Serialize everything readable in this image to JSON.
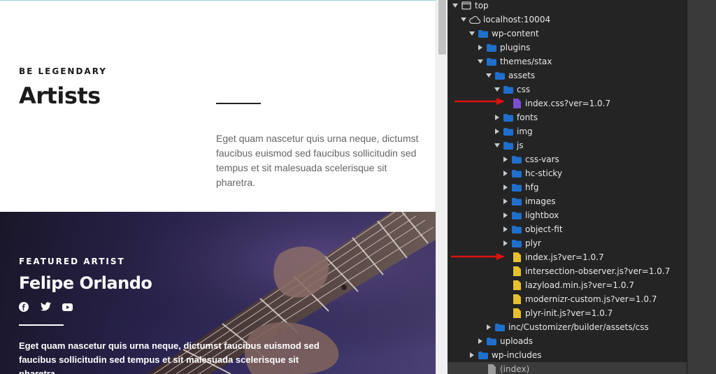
{
  "page": {
    "eyebrow": "BE LEGENDARY",
    "title": "Artists",
    "intro": "Eget quam nascetur quis urna neque, dictumst faucibus euismod sed faucibus sollicitudin sed tempus et sit malesuada scelerisque sit pharetra.",
    "hero": {
      "eyebrow": "FEATURED ARTIST",
      "name": "Felipe Orlando",
      "social_icons": [
        "facebook-icon",
        "twitter-icon",
        "youtube-icon"
      ],
      "text": "Eget quam nascetur quis urna neque, dictumst faucibus euismod sed faucibus sollicitudin sed tempus et sit malesuada scelerisque sit pharetra."
    }
  },
  "devtools": {
    "tree": [
      {
        "label": "top",
        "icon": "frame-icon",
        "expanded": true,
        "depth": 0
      },
      {
        "label": "localhost:10004",
        "icon": "cloud-icon",
        "expanded": true,
        "depth": 1
      },
      {
        "label": "wp-content",
        "icon": "folder-icon",
        "expanded": true,
        "depth": 2
      },
      {
        "label": "plugins",
        "icon": "folder-icon",
        "expanded": false,
        "depth": 3
      },
      {
        "label": "themes/stax",
        "icon": "folder-icon",
        "expanded": true,
        "depth": 3
      },
      {
        "label": "assets",
        "icon": "folder-icon",
        "expanded": true,
        "depth": 4
      },
      {
        "label": "css",
        "icon": "folder-icon",
        "expanded": true,
        "depth": 5
      },
      {
        "label": "index.css?ver=1.0.7",
        "icon": "css-file-icon",
        "expanded": null,
        "depth": 6,
        "highlight": true
      },
      {
        "label": "fonts",
        "icon": "folder-icon",
        "expanded": false,
        "depth": 5
      },
      {
        "label": "img",
        "icon": "folder-icon",
        "expanded": false,
        "depth": 5
      },
      {
        "label": "js",
        "icon": "folder-icon",
        "expanded": true,
        "depth": 5
      },
      {
        "label": "css-vars",
        "icon": "folder-icon",
        "expanded": false,
        "depth": 6
      },
      {
        "label": "hc-sticky",
        "icon": "folder-icon",
        "expanded": false,
        "depth": 6
      },
      {
        "label": "hfg",
        "icon": "folder-icon",
        "expanded": false,
        "depth": 6
      },
      {
        "label": "images",
        "icon": "folder-icon",
        "expanded": false,
        "depth": 6
      },
      {
        "label": "lightbox",
        "icon": "folder-icon",
        "expanded": false,
        "depth": 6
      },
      {
        "label": "object-fit",
        "icon": "folder-icon",
        "expanded": false,
        "depth": 6
      },
      {
        "label": "plyr",
        "icon": "folder-icon",
        "expanded": false,
        "depth": 6
      },
      {
        "label": "index.js?ver=1.0.7",
        "icon": "js-file-icon",
        "expanded": null,
        "depth": 6,
        "highlight": true
      },
      {
        "label": "intersection-observer.js?ver=1.0.7",
        "icon": "js-file-icon",
        "expanded": null,
        "depth": 6
      },
      {
        "label": "lazyload.min.js?ver=1.0.7",
        "icon": "js-file-icon",
        "expanded": null,
        "depth": 6
      },
      {
        "label": "modernizr-custom.js?ver=1.0.7",
        "icon": "js-file-icon",
        "expanded": null,
        "depth": 6
      },
      {
        "label": "plyr-init.js?ver=1.0.7",
        "icon": "js-file-icon",
        "expanded": null,
        "depth": 6
      },
      {
        "label": "inc/Customizer/builder/assets/css",
        "icon": "folder-icon",
        "expanded": false,
        "depth": 4
      },
      {
        "label": "uploads",
        "icon": "folder-icon",
        "expanded": false,
        "depth": 3
      },
      {
        "label": "wp-includes",
        "icon": "folder-icon",
        "expanded": false,
        "depth": 2
      },
      {
        "label": "(index)",
        "icon": "generic-file-icon",
        "expanded": null,
        "depth": 3,
        "selected": true
      }
    ]
  },
  "colors": {
    "folder": "#1f6fcc",
    "css_file": "#7a4fd1",
    "js_file": "#e6c12e",
    "generic_file": "#9a9a9a",
    "annotation_arrow": "#e01010"
  }
}
